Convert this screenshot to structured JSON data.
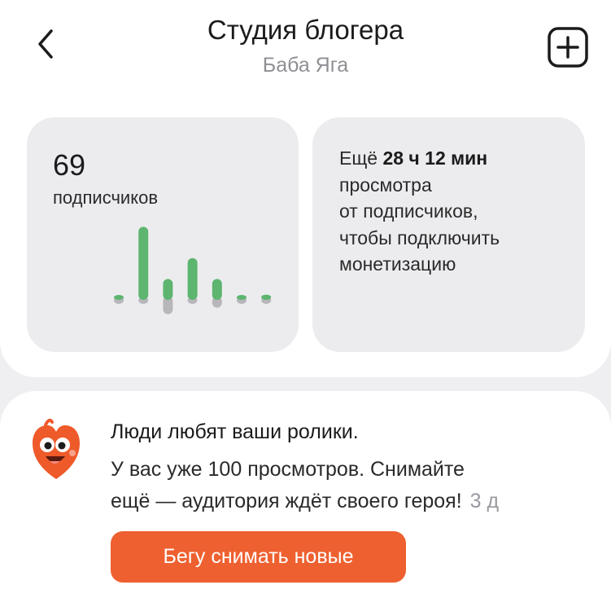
{
  "header": {
    "title": "Студия блогера",
    "subtitle": "Баба Яга",
    "back_icon": "chevron-left-icon",
    "add_icon": "plus-square-icon"
  },
  "subscribers": {
    "count": "69",
    "label": "подписчиков",
    "bars": [
      {
        "up": 0.12,
        "down": 0.15
      },
      {
        "up": 2.8,
        "down": 0.15
      },
      {
        "up": 0.8,
        "down": 0.55
      },
      {
        "up": 1.6,
        "down": 0.15
      },
      {
        "up": 0.8,
        "down": 0.3
      },
      {
        "up": 0.12,
        "down": 0.1
      },
      {
        "up": 0.2,
        "down": 0.1
      }
    ],
    "colors": {
      "up": "#5db56f",
      "down": "#b7b7bb"
    }
  },
  "monetization": {
    "prefix": "Ещё",
    "time": "28 ч 12 мин",
    "line2": "просмотра",
    "line3": "от подписчиков,",
    "line4": "чтобы подключить",
    "line5": "монетизацию"
  },
  "promo": {
    "title": "Люди любят ваши ролики.",
    "line1": "У вас уже 100 просмотров. Снимайте",
    "line2": "ещё — аудитория ждёт своего героя!",
    "time": "3 д",
    "button_label": "Бегу снимать новые",
    "mascot_icon": "heart-mascot-icon",
    "accent": "#ee6030"
  }
}
